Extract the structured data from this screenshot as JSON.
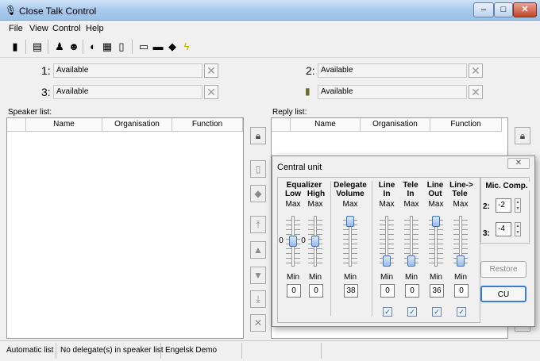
{
  "window": {
    "title": "Close Talk Control"
  },
  "menu": [
    "File",
    "View",
    "Control",
    "Help"
  ],
  "channels": [
    {
      "num": "1:",
      "value": "Available"
    },
    {
      "num": "2:",
      "value": "Available"
    },
    {
      "num": "3:",
      "value": "Available"
    },
    {
      "num": "",
      "value": "Available"
    }
  ],
  "speaker": {
    "label": "Speaker list:",
    "cols": [
      "Name",
      "Organisation",
      "Function"
    ]
  },
  "reply": {
    "label": "Reply list:",
    "cols": [
      "Name",
      "Organisation",
      "Function"
    ]
  },
  "dialog": {
    "title": "Central unit",
    "groups": {
      "equalizer": "Equalizer",
      "low": "Low",
      "high": "High",
      "delegate": "Delegate",
      "volume": "Volume",
      "line1": "Line",
      "in1": "In",
      "tele1": "Tele",
      "in2": "In",
      "line2": "Line",
      "out": "Out",
      "line3": "Line->",
      "tele2": "Tele"
    },
    "max": "Max",
    "min": "Min",
    "zero_low": "0",
    "zero_high": "0",
    "values": [
      "0",
      "0",
      "38",
      "0",
      "0",
      "36",
      "0"
    ],
    "mic_comp": {
      "title": "Mic. Comp.",
      "r2_label": "2:",
      "r2_value": "-2",
      "r3_label": "3:",
      "r3_value": "-4"
    },
    "restore": "Restore",
    "cu": "CU"
  },
  "status": [
    "Automatic list",
    "No delegate(s) in speaker list",
    "Engelsk Demo"
  ]
}
